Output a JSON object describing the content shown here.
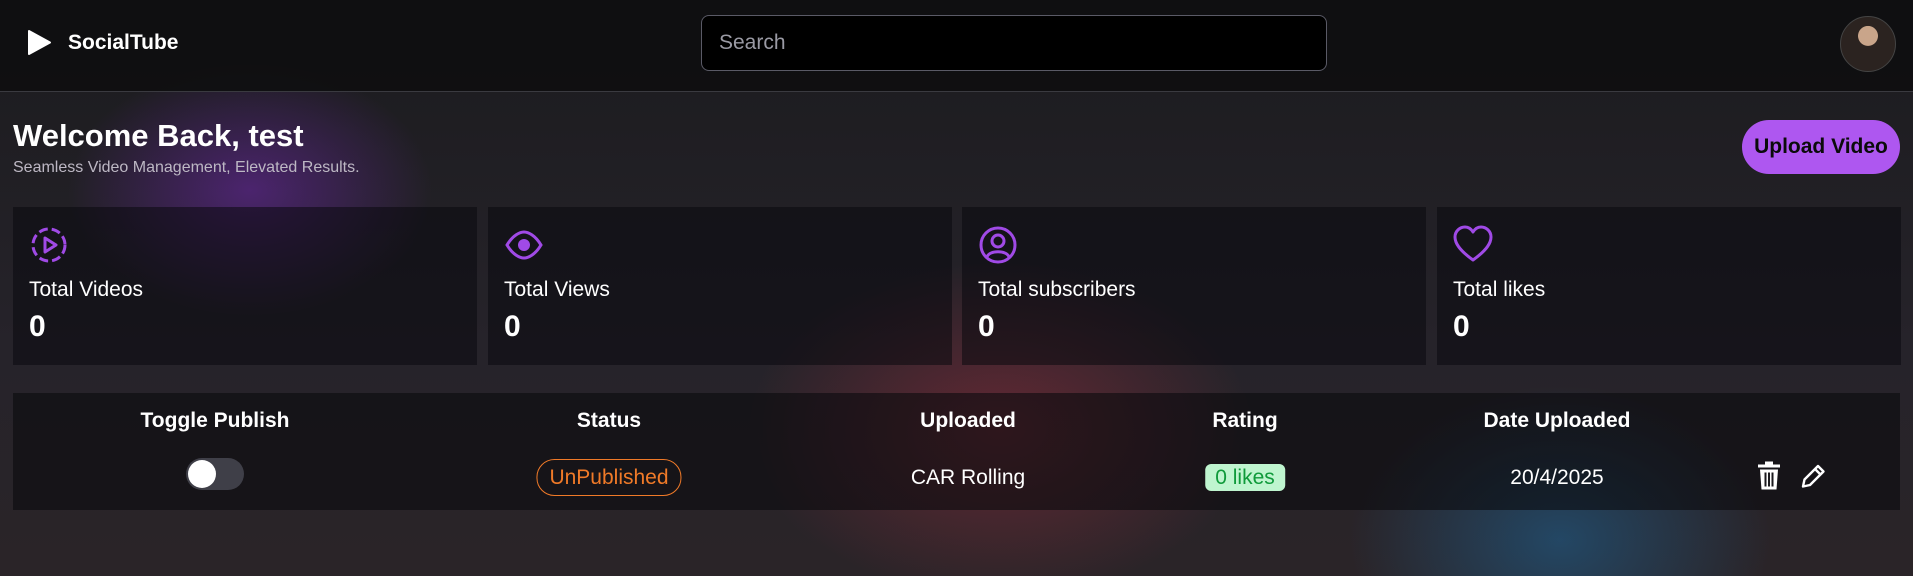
{
  "app": {
    "name": "SocialTube",
    "logo_icon": "play-icon"
  },
  "search": {
    "placeholder": "Search",
    "value": ""
  },
  "user": {
    "avatar_icon": "user-avatar"
  },
  "dashboard": {
    "welcome": "Welcome Back, test",
    "tagline": "Seamless Video Management, Elevated Results.",
    "upload_label": "Upload Video"
  },
  "stats": [
    {
      "label": "Total Videos",
      "value": "0",
      "icon": "play-circle-icon"
    },
    {
      "label": "Total Views",
      "value": "0",
      "icon": "eye-icon"
    },
    {
      "label": "Total subscribers",
      "value": "0",
      "icon": "user-circle-icon"
    },
    {
      "label": "Total likes",
      "value": "0",
      "icon": "heart-icon"
    }
  ],
  "table": {
    "headers": [
      "Toggle Publish",
      "Status",
      "Uploaded",
      "Rating",
      "Date Uploaded"
    ],
    "rows": [
      {
        "published": false,
        "status": "UnPublished",
        "title": "CAR Rolling",
        "rating": "0 likes",
        "date": "20/4/2025",
        "actions": [
          "trash-icon",
          "edit-icon"
        ]
      }
    ]
  },
  "colors": {
    "accent": "#ae57f0",
    "unpublished": "#f07a28",
    "likes_bg": "#bff5cf",
    "likes_text": "#0f9a3a"
  }
}
